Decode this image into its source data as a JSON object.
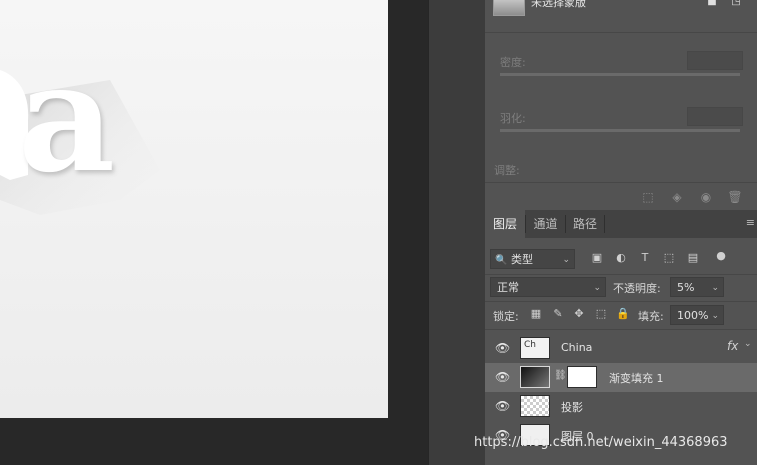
{
  "canvas": {
    "glyph_text": "a"
  },
  "properties": {
    "mask_label": "未选择蒙版",
    "density_label": "密度:",
    "feather_label": "羽化:",
    "adjust_label": "调整:"
  },
  "layers_panel": {
    "tabs": [
      {
        "label": "图层",
        "active": true
      },
      {
        "label": "通道",
        "active": false
      },
      {
        "label": "路径",
        "active": false
      }
    ],
    "filter_kind": "类型",
    "blend_mode": "正常",
    "opacity_label": "不透明度:",
    "opacity_value": "5%",
    "lock_label": "锁定:",
    "fill_label": "填充:",
    "fill_value": "100%",
    "layers": [
      {
        "name": "China",
        "fx": "fx",
        "selected": false
      },
      {
        "name": "渐变填充 1",
        "selected": true
      },
      {
        "name": "投影",
        "selected": false
      },
      {
        "name": "图层 0",
        "selected": false
      }
    ]
  },
  "watermark": "https://blog.csdn.net/weixin_44368963",
  "colors": {
    "panel_bg": "#535353",
    "canvas_bg": "#f0f0f0",
    "workspace_bg": "#282828",
    "selected_layer": "#6a6a6a"
  }
}
